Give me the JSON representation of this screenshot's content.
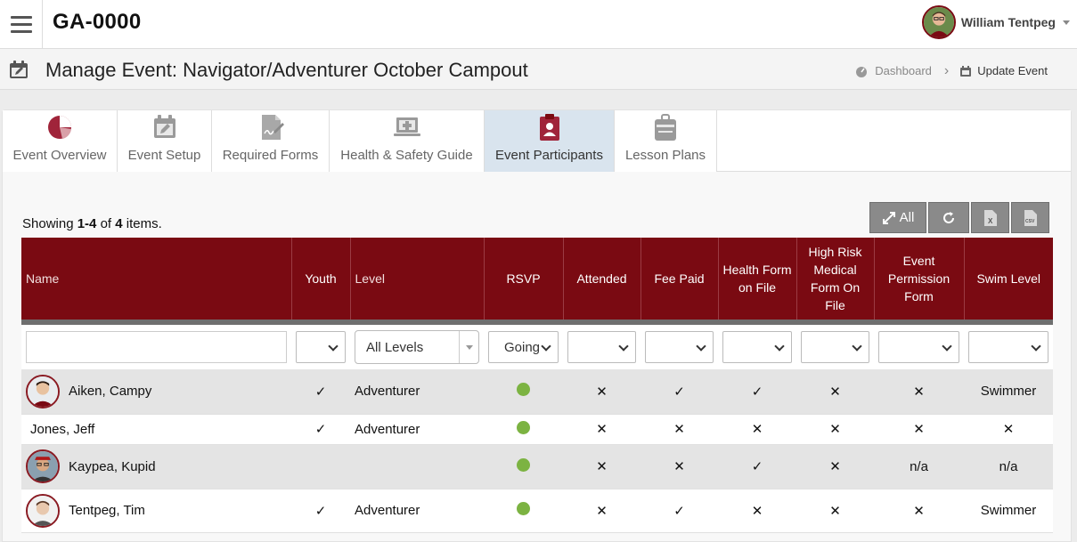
{
  "app": {
    "title": "GA-0000"
  },
  "user": {
    "name": "William Tentpeg"
  },
  "page": {
    "title": "Manage Event: Navigator/Adventurer October Campout"
  },
  "breadcrumb": {
    "home": "Dashboard",
    "current": "Update Event"
  },
  "tabs": [
    {
      "label": "Event Overview",
      "icon": "pie-chart-icon",
      "color": "#a0243a"
    },
    {
      "label": "Event Setup",
      "icon": "calendar-edit-icon",
      "color": "#9a9a9a"
    },
    {
      "label": "Required Forms",
      "icon": "document-signature-icon",
      "color": "#9a9a9a"
    },
    {
      "label": "Health & Safety Guide",
      "icon": "medical-laptop-icon",
      "color": "#9a9a9a"
    },
    {
      "label": "Event Participants",
      "icon": "clipboard-person-icon",
      "color": "#a0243a",
      "active": true
    },
    {
      "label": "Lesson Plans",
      "icon": "briefcase-icon",
      "color": "#9a9a9a"
    }
  ],
  "summary": {
    "prefix": "Showing ",
    "range": "1-4",
    "of": " of ",
    "count": "4",
    "suffix": " items."
  },
  "toolbar": {
    "expand_label": "All",
    "expand_icon": "expand-arrows-icon",
    "refresh_icon": "refresh-icon",
    "excel_icon": "excel-file-icon",
    "csv_icon": "csv-file-icon"
  },
  "table": {
    "columns": {
      "name": "Name",
      "youth": "Youth",
      "level": "Level",
      "rsvp": "RSVP",
      "attended": "Attended",
      "fee_paid": "Fee Paid",
      "health_form": "Health Form on File",
      "high_risk": "High Risk Medical Form On File",
      "permission": "Event Permission Form",
      "swim": "Swim Level"
    },
    "filters": {
      "level": "All Levels",
      "rsvp": "Going"
    },
    "rows": [
      {
        "name": "Aiken, Campy",
        "youth": "✓",
        "level": "Adventurer",
        "attended": "✕",
        "fee_paid": "✓",
        "health_form": "✓",
        "high_risk": "✕",
        "permission": "✕",
        "swim": "Swimmer"
      },
      {
        "name": "Jones, Jeff",
        "youth": "✓",
        "level": "Adventurer",
        "attended": "✕",
        "fee_paid": "✕",
        "health_form": "✕",
        "high_risk": "✕",
        "permission": "✕",
        "swim": "✕"
      },
      {
        "name": "Kaypea, Kupid",
        "youth": "",
        "level": "",
        "attended": "✕",
        "fee_paid": "✕",
        "health_form": "✓",
        "high_risk": "✕",
        "permission": "n/a",
        "swim": "n/a"
      },
      {
        "name": "Tentpeg, Tim",
        "youth": "✓",
        "level": "Adventurer",
        "attended": "✕",
        "fee_paid": "✓",
        "health_form": "✕",
        "high_risk": "✕",
        "permission": "✕",
        "swim": "Swimmer"
      }
    ]
  },
  "colors": {
    "header_bg": "#7a0a12",
    "accent": "#a0243a",
    "rsvp_going": "#7cb342",
    "x_red": "#e05a5a"
  }
}
